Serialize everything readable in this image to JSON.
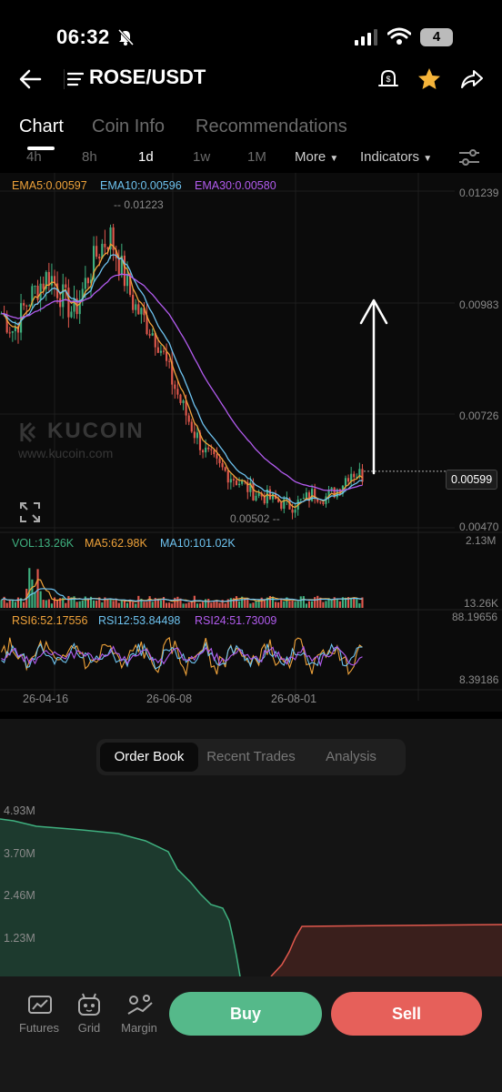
{
  "status_bar": {
    "time": "06:32",
    "battery": "4"
  },
  "header": {
    "pair": "ROSE/USDT"
  },
  "tabs": [
    {
      "label": "Chart"
    },
    {
      "label": "Coin Info"
    },
    {
      "label": "Recommendations"
    }
  ],
  "timeframes": [
    "4h",
    "8h",
    "1d",
    "1w",
    "1M"
  ],
  "timeframe_active": "1d",
  "more_label": "More",
  "indicators_label": "Indicators",
  "ema": {
    "ema5": "EMA5:0.00597",
    "ema10": "EMA10:0.00596",
    "ema30": "EMA30:0.00580"
  },
  "price_axis": [
    "0.01239",
    "0.00983",
    "0.00726",
    "0.00470"
  ],
  "high_label": "0.01223",
  "low_label": "0.00502",
  "current_price": "0.00599",
  "watermark": {
    "brand": "KUCOIN",
    "url": "www.kucoin.com"
  },
  "volume": {
    "vol": "VOL:13.26K",
    "ma5": "MA5:62.98K",
    "ma10": "MA10:101.02K",
    "axis_top": "2.13M",
    "axis_bottom": "13.26K"
  },
  "rsi": {
    "rsi6": "RSI6:52.17556",
    "rsi12": "RSI12:53.84498",
    "rsi24": "RSI24:51.73009",
    "axis_top": "88.19656",
    "axis_bottom": "8.39186"
  },
  "dates": [
    "26-04-16",
    "26-06-08",
    "26-08-01"
  ],
  "order_tabs": [
    {
      "label": "Order Book"
    },
    {
      "label": "Recent Trades"
    },
    {
      "label": "Analysis"
    }
  ],
  "depth_axis": [
    "4.93M",
    "3.70M",
    "2.46M",
    "1.23M"
  ],
  "bottom_nav": [
    {
      "label": "Futures"
    },
    {
      "label": "Grid"
    },
    {
      "label": "Margin"
    }
  ],
  "buy_label": "Buy",
  "sell_label": "Sell",
  "colors": {
    "up": "#3fb07f",
    "down": "#e0584d",
    "ema5": "#f0a33a",
    "ema10": "#6ec3f0",
    "ema30": "#b35cf0",
    "buy_btn": "#55b98a",
    "sell_btn": "#e6605a"
  },
  "chart_data": {
    "type": "candlestick",
    "x_labels": [
      "26-04-16",
      "26-06-08",
      "26-08-01"
    ],
    "ylim": [
      0.0047,
      0.01239
    ],
    "close_approx": [
      0.0096,
      0.0092,
      0.0098,
      0.0102,
      0.0105,
      0.01,
      0.0096,
      0.0103,
      0.011,
      0.0114,
      0.0106,
      0.0098,
      0.0094,
      0.009,
      0.0082,
      0.0075,
      0.0069,
      0.0064,
      0.0061,
      0.0059,
      0.0057,
      0.0055,
      0.0054,
      0.0053,
      0.0052,
      0.0053,
      0.0055,
      0.0054,
      0.0056,
      0.006,
      0.0059
    ],
    "high": 0.01223,
    "low": 0.00502,
    "last": 0.00599
  }
}
